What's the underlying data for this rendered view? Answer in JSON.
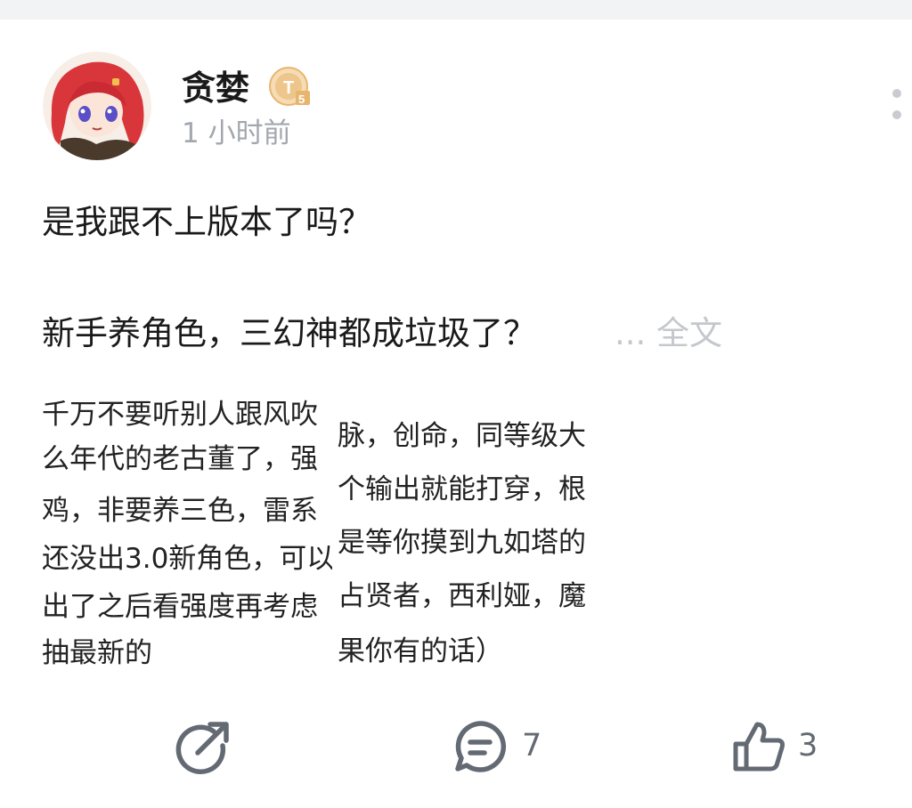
{
  "post": {
    "author": {
      "name": "贪婪",
      "badge": "T5",
      "time": "1 小时前"
    },
    "title": "是我跟不上版本了吗？",
    "body": "新手养角色，三幻神都成垃圾了？",
    "expand_label": "... 全文",
    "images": [
      {
        "lines": [
          "千万不要听别人跟风吹",
          "么年代的老古董了，强",
          "鸡，非要养三色，雷系",
          "还没出3.0新角色，可以",
          "出了之后看强度再考虑",
          "抽最新的"
        ]
      },
      {
        "lines": [
          "脉，创命，同等级大",
          "个输出就能打穿，根",
          "是等你摸到九如塔的",
          "占贤者，西利娅，魔",
          "果你有的话）"
        ]
      }
    ],
    "actions": {
      "comments": "7",
      "likes": "3"
    }
  },
  "icons": {
    "share": "share-icon",
    "comment": "comment-icon",
    "like": "thumbs-up-icon",
    "more": "more-vertical-icon"
  },
  "colors": {
    "badge_gold": "#e8b56d",
    "muted": "#a2a7ae",
    "icon_gray": "#646a73"
  }
}
